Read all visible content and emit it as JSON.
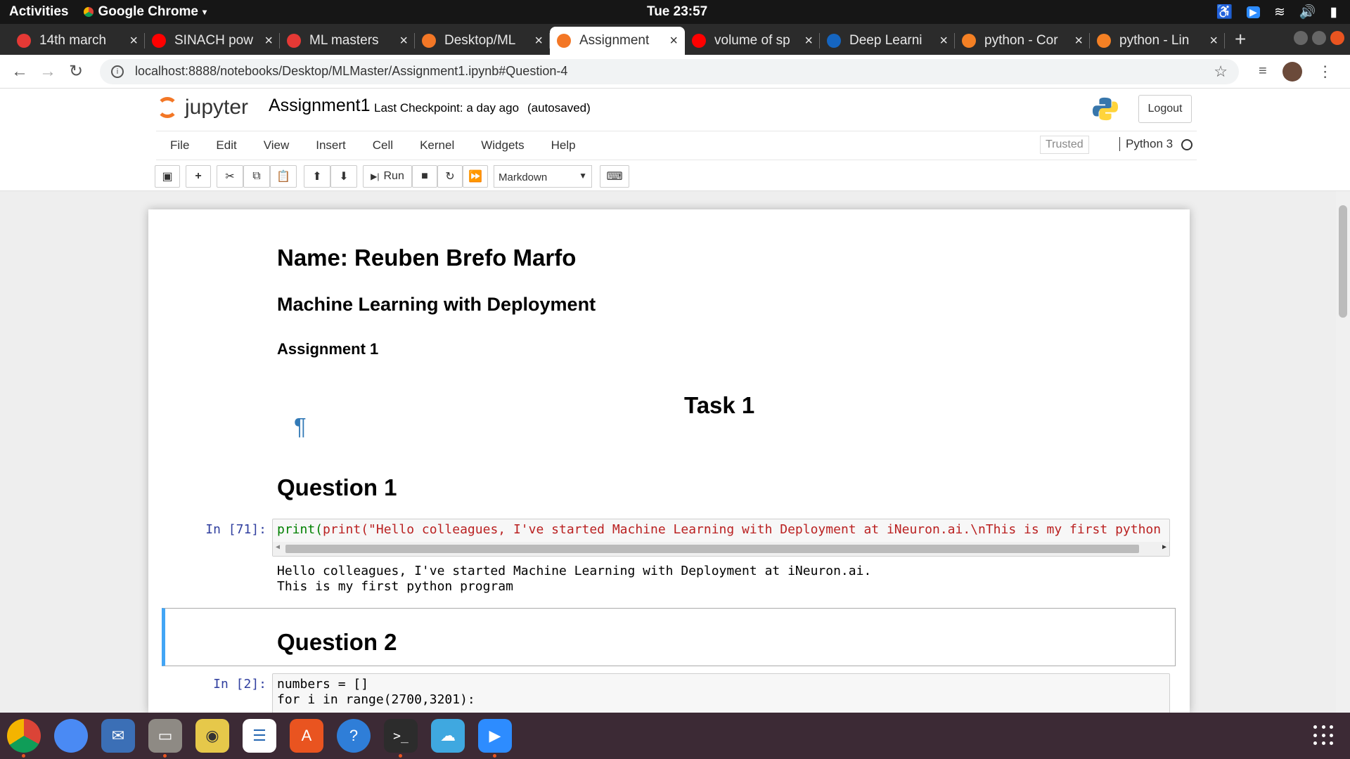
{
  "topbar": {
    "activities": "Activities",
    "app": "Google Chrome",
    "clock": "Tue 23:57"
  },
  "tabs": [
    {
      "title": "14th march",
      "color": "#e53935"
    },
    {
      "title": "SINACH pow",
      "color": "#ff0000"
    },
    {
      "title": "ML masters",
      "color": "#e53935"
    },
    {
      "title": "Desktop/ML",
      "color": "#f37726"
    },
    {
      "title": "Assignment",
      "color": "#f37726",
      "active": true
    },
    {
      "title": "volume of sp",
      "color": "#ff0000"
    },
    {
      "title": "Deep Learni",
      "color": "#1565c0"
    },
    {
      "title": "python - Cor",
      "color": "#f48024"
    },
    {
      "title": "python - Lin",
      "color": "#f48024"
    }
  ],
  "address": {
    "url": "localhost:8888/notebooks/Desktop/MLMaster/Assignment1.ipynb#Question-4"
  },
  "header": {
    "logo_text": "jupyter",
    "notebook_name": "Assignment1",
    "checkpoint": "Last Checkpoint: a day ago",
    "autosaved": "(autosaved)",
    "logout": "Logout"
  },
  "menubar": {
    "items": [
      "File",
      "Edit",
      "View",
      "Insert",
      "Cell",
      "Kernel",
      "Widgets",
      "Help"
    ],
    "trusted": "Trusted",
    "kernel": "Python 3"
  },
  "toolbar": {
    "run": "Run",
    "cell_type": "Markdown"
  },
  "notebook": {
    "name_heading": "Name: Reuben Brefo Marfo",
    "course": "Machine Learning with Deployment",
    "assignment": "Assignment 1",
    "task": "Task 1",
    "pilcrow": "¶",
    "q1": "Question 1",
    "cell1_prompt": "In [71]:",
    "cell1_code": "print(\"Hello colleagues, I've started Machine Learning with Deployment at iNeuron.ai.\\nThis is my first python progr",
    "cell1_out_line1": "Hello colleagues, I've started Machine Learning with Deployment at iNeuron.ai.",
    "cell1_out_line2": "This is my first python program",
    "q2": "Question 2",
    "cell2_prompt": "In [2]:",
    "cell2_line1": "numbers = []",
    "cell2_line2": "for i in range(2700,3201):"
  },
  "dock": [
    "Chrome",
    "Chromium",
    "Mail",
    "Files",
    "Music",
    "Writer",
    "Software",
    "Help",
    "Terminal",
    "Cloud",
    "Zoom"
  ]
}
